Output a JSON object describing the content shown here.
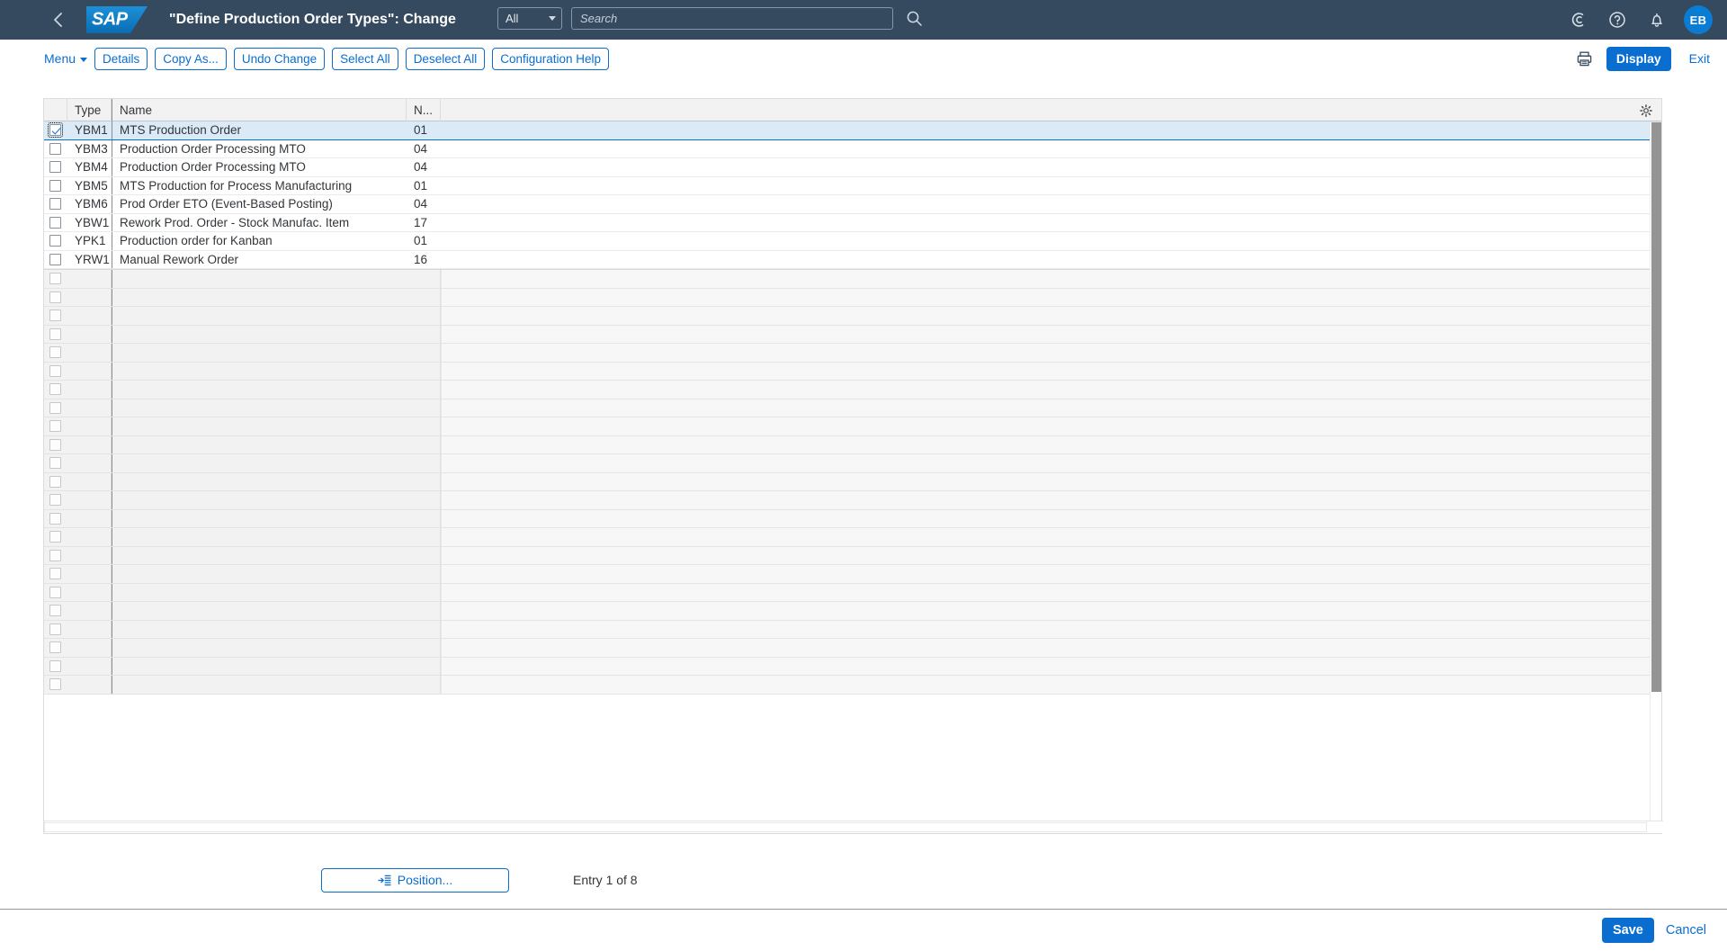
{
  "shell": {
    "back_icon": "chevron-left-icon",
    "logo_text": "SAP",
    "title": "\"Define Production Order Types\": Change",
    "search": {
      "scope_label": "All",
      "placeholder": "Search",
      "value": "",
      "go_icon": "search-icon"
    },
    "actions": [
      {
        "icon": "copilot-icon",
        "label": "Co-Pilot"
      },
      {
        "icon": "question-mark-icon",
        "label": "Help"
      },
      {
        "icon": "bell-icon",
        "label": "Notifications"
      }
    ],
    "avatar_initials": "EB"
  },
  "toolbar": {
    "menu_label": "Menu",
    "buttons": [
      {
        "label": "Details"
      },
      {
        "label": "Copy As..."
      },
      {
        "label": "Undo Change"
      },
      {
        "label": "Select All"
      },
      {
        "label": "Deselect All"
      },
      {
        "label": "Configuration Help"
      }
    ],
    "print_icon": "printer-icon",
    "display_label": "Display",
    "exit_label": "Exit"
  },
  "table": {
    "settings_icon": "gear-icon",
    "columns": [
      {
        "key": "check",
        "label": ""
      },
      {
        "key": "type",
        "label": "Type"
      },
      {
        "key": "name",
        "label": "Name"
      },
      {
        "key": "num",
        "label": "N..."
      }
    ],
    "rows": [
      {
        "selected": true,
        "type": "YBM1",
        "name": "MTS Production Order",
        "num": "01"
      },
      {
        "selected": false,
        "type": "YBM3",
        "name": "Production Order Processing MTO",
        "num": "04"
      },
      {
        "selected": false,
        "type": "YBM4",
        "name": "Production Order Processing MTO",
        "num": "04"
      },
      {
        "selected": false,
        "type": "YBM5",
        "name": "MTS Production for Process Manufacturing",
        "num": "01"
      },
      {
        "selected": false,
        "type": "YBM6",
        "name": "Prod Order ETO (Event-Based Posting)",
        "num": "04"
      },
      {
        "selected": false,
        "type": "YBW1",
        "name": "Rework Prod. Order - Stock Manufac. Item",
        "num": "17"
      },
      {
        "selected": false,
        "type": "YPK1",
        "name": "Production order for Kanban",
        "num": "01"
      },
      {
        "selected": false,
        "type": "YRW1",
        "name": "Manual Rework Order",
        "num": "16"
      }
    ],
    "empty_row_count": 23
  },
  "position_bar": {
    "position_icon": "goto-list-icon",
    "position_label": "Position...",
    "entry_status": "Entry 1 of 8"
  },
  "footer": {
    "save_label": "Save",
    "cancel_label": "Cancel"
  },
  "colors": {
    "shell_bg": "#354a5f",
    "accent": "#0a6ed1",
    "selected_row": "#dbeaf7",
    "header_row": "#f2f2f2",
    "empty_row": "#f2f2f2",
    "avatar_bg": "#0a7cd4"
  }
}
